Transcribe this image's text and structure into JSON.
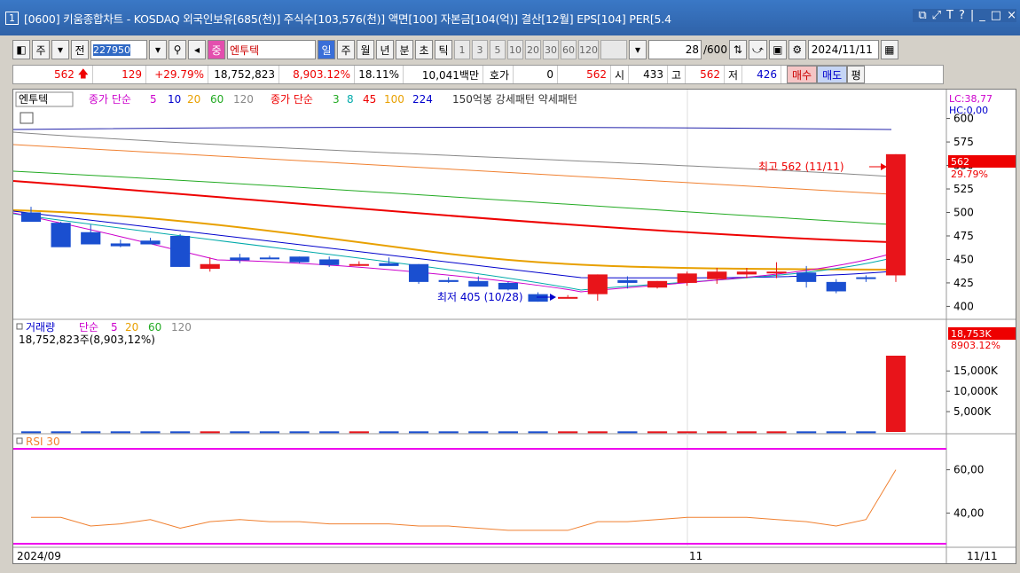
{
  "window": {
    "num": "1",
    "title": "[0600] 키움종합차트 - KOSDAQ 외국인보유[685(천)] 주식수[103,576(천)] 액면[100] 자본금[104(억)] 결산[12월] EPS[104] PER[5.4",
    "ctrls": [
      "⧉",
      "⤢",
      "T",
      "?",
      "|",
      "_",
      "□",
      "×"
    ]
  },
  "toolbar": {
    "kind": "주",
    "prefix": "전",
    "code": "227950",
    "name": "엔투텍",
    "name_tag": "중",
    "periods": [
      "일",
      "주",
      "월",
      "년",
      "분",
      "초",
      "틱"
    ],
    "nums": [
      "1",
      "3",
      "5",
      "10",
      "20",
      "30",
      "60",
      "120"
    ],
    "count": "28",
    "count_total": "/600",
    "date": "2024/11/11"
  },
  "quote": {
    "price": "562",
    "change": "129",
    "pct": "+29.79%",
    "volume": "18,752,823",
    "vol_ratio": "8,903.12%",
    "turnover": "18.11%",
    "amount": "10,041백만",
    "bid_label": "호가",
    "bid": "0",
    "ask": "562",
    "open_label": "시",
    "open": "433",
    "high_label": "고",
    "high": "562",
    "low_label": "저",
    "low": "426",
    "buy": "매수",
    "sell": "매도",
    "avg": "평"
  },
  "price_panel": {
    "legend": [
      "엔투텍",
      "종가 단순",
      "5",
      "10",
      "20",
      "60",
      "120",
      "종가 단순",
      "3",
      "8",
      "45",
      "100",
      "224",
      "150억봉 강세패턴 약세패턴"
    ],
    "lc": "LC:38,77",
    "hc": "HC:0,00",
    "last_price": "562",
    "last_pct": "29.79%",
    "high_note": "최고 562 (11/11)",
    "low_note": "최저 405 (10/28)",
    "yticks": [
      "600",
      "575",
      "550",
      "525",
      "500",
      "475",
      "450",
      "425",
      "400"
    ]
  },
  "volume_panel": {
    "legend": [
      "거래량",
      "단순",
      "5",
      "20",
      "60",
      "120"
    ],
    "sub": "18,752,823주(8,903,12%)",
    "last": "18,753K",
    "last_pct": "8903.12%",
    "yticks": [
      "15,000K",
      "10,000K",
      "5,000K"
    ]
  },
  "rsi_panel": {
    "legend": "RSI 30",
    "yticks": [
      "60,00",
      "40,00"
    ]
  },
  "xaxis": {
    "left": "2024/09",
    "mid": "11",
    "right": "11/11"
  },
  "chart_data": {
    "type": "candlestick",
    "candles": [
      [
        500,
        506,
        491,
        490
      ],
      [
        489,
        490,
        481,
        463
      ],
      [
        479,
        487,
        468,
        466
      ],
      [
        467,
        471,
        463,
        464
      ],
      [
        470,
        473,
        467,
        466
      ],
      [
        475,
        477,
        442,
        442
      ],
      [
        440,
        452,
        437,
        445
      ],
      [
        452,
        456,
        446,
        449
      ],
      [
        452,
        454,
        451,
        451
      ],
      [
        453,
        453,
        446,
        447
      ],
      [
        450,
        453,
        442,
        444
      ],
      [
        445,
        448,
        443,
        445
      ],
      [
        446,
        452,
        444,
        443
      ],
      [
        445,
        445,
        424,
        426
      ],
      [
        428,
        431,
        425,
        426
      ],
      [
        427,
        432,
        423,
        421
      ],
      [
        425,
        426,
        417,
        418
      ],
      [
        413,
        415,
        405,
        405
      ],
      [
        410,
        412,
        410,
        410
      ],
      [
        413,
        434,
        406,
        434
      ],
      [
        428,
        432,
        419,
        425
      ],
      [
        420,
        427,
        419,
        427
      ],
      [
        425,
        437,
        422,
        435
      ],
      [
        429,
        441,
        424,
        437
      ],
      [
        434,
        441,
        430,
        437
      ],
      [
        436,
        447,
        430,
        437
      ],
      [
        436,
        443,
        420,
        426
      ],
      [
        426,
        429,
        414,
        416
      ],
      [
        431,
        433,
        426,
        430
      ],
      [
        433,
        562,
        426,
        562
      ]
    ],
    "volume_max": 18752823,
    "volume_last": 18752823,
    "rsi": [
      38,
      38,
      34,
      35,
      37,
      33,
      36,
      37,
      36,
      36,
      35,
      35,
      35,
      34,
      34,
      33,
      32,
      32,
      32,
      36,
      36,
      37,
      38,
      38,
      38,
      37,
      36,
      34,
      37,
      60
    ],
    "ylim_price": [
      390,
      610
    ],
    "ylim_rsi": [
      25,
      75
    ]
  }
}
